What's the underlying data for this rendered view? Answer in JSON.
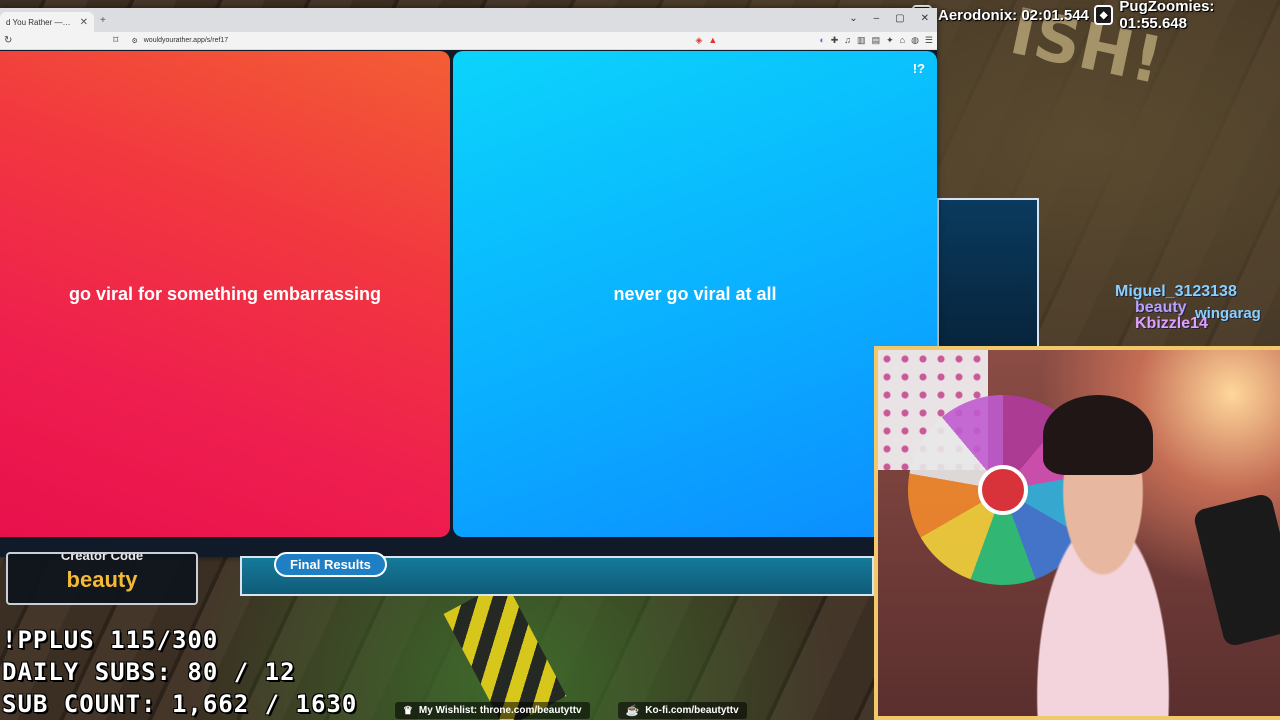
{
  "hud": {
    "timer1": "Aerodonix: 02:01.544",
    "timer2": "PugZoomies: 01:55.648"
  },
  "browser": {
    "tab_title": "d You Rather — Play the O",
    "url": "wouldyourather.app/s/ref17",
    "window_controls": [
      "⌄",
      "–",
      "▢",
      "✕"
    ]
  },
  "game": {
    "option_a": "go viral for something embarrassing",
    "option_b": "never go viral at all",
    "help_label": "!?"
  },
  "overlay": {
    "creator_code_label": "Creator Code",
    "creator_code": "beauty",
    "final_results": "Final Results",
    "stats": {
      "plus": "!PPLUS 115/300",
      "daily_subs": "DAILY SUBS: 80 / 12",
      "sub_count": "SUB COUNT: 1,662 / 1630"
    },
    "wishlist": "My Wishlist: throne.com/beautyttv",
    "kofi": "Ko-fi.com/beautyttv"
  },
  "chat": {
    "names": [
      "Miguel_3123138",
      "beauty",
      "wingarag",
      "Kbizzle14"
    ]
  }
}
